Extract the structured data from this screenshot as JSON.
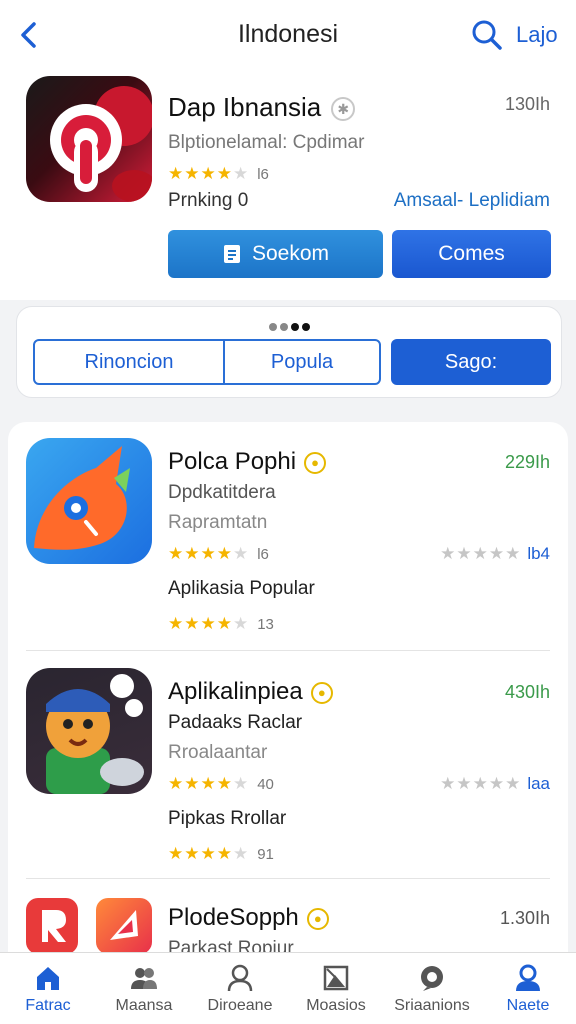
{
  "nav": {
    "title": "Ilndonesi",
    "link": "Lajo"
  },
  "featured": {
    "title": "Dap Ibnansia",
    "size": "130Ih",
    "subtitle": "Blptionelamal: Cpdimar",
    "rating_count": "l6",
    "rank": "Prnking 0",
    "link": "Amsaal- Leplidiam",
    "install_label": "Soekom",
    "open_label": "Comes"
  },
  "segments": [
    "Rinoncion",
    "Popula",
    "Sago:"
  ],
  "apps": [
    {
      "title": "Polca Pophi",
      "size": "229Ih",
      "line1": "Dpdkatitdera",
      "line2": "Rapramtatn",
      "rating1": "l6",
      "rating2_label": "lb4",
      "line3": "Aplikasia Popular",
      "rating3": "13"
    },
    {
      "title": "Aplikalinpiea",
      "size": "430Ih",
      "line1": "Padaaks Raclar",
      "line2": "Rroalaantar",
      "rating1": "40",
      "rating2_label": "laa",
      "line3": "Pipkas Rrollar",
      "rating3": "91"
    },
    {
      "title": "PlodeSopph",
      "size": "1.30Ih",
      "line1": "Parkast Ropiur"
    }
  ],
  "tabs": [
    {
      "label": "Fatrac",
      "icon": "home-icon"
    },
    {
      "label": "Maansa",
      "icon": "people-icon"
    },
    {
      "label": "Diroeane",
      "icon": "person-icon"
    },
    {
      "label": "Moasios",
      "icon": "image-icon"
    },
    {
      "label": "Sriaanions",
      "icon": "chat-icon"
    },
    {
      "label": "Naete",
      "icon": "profile-icon"
    }
  ],
  "colors": {
    "accent": "#1d5fd4",
    "install_button": "#2a86d8",
    "star": "#f5b400",
    "size_green": "#3a9a4a"
  }
}
